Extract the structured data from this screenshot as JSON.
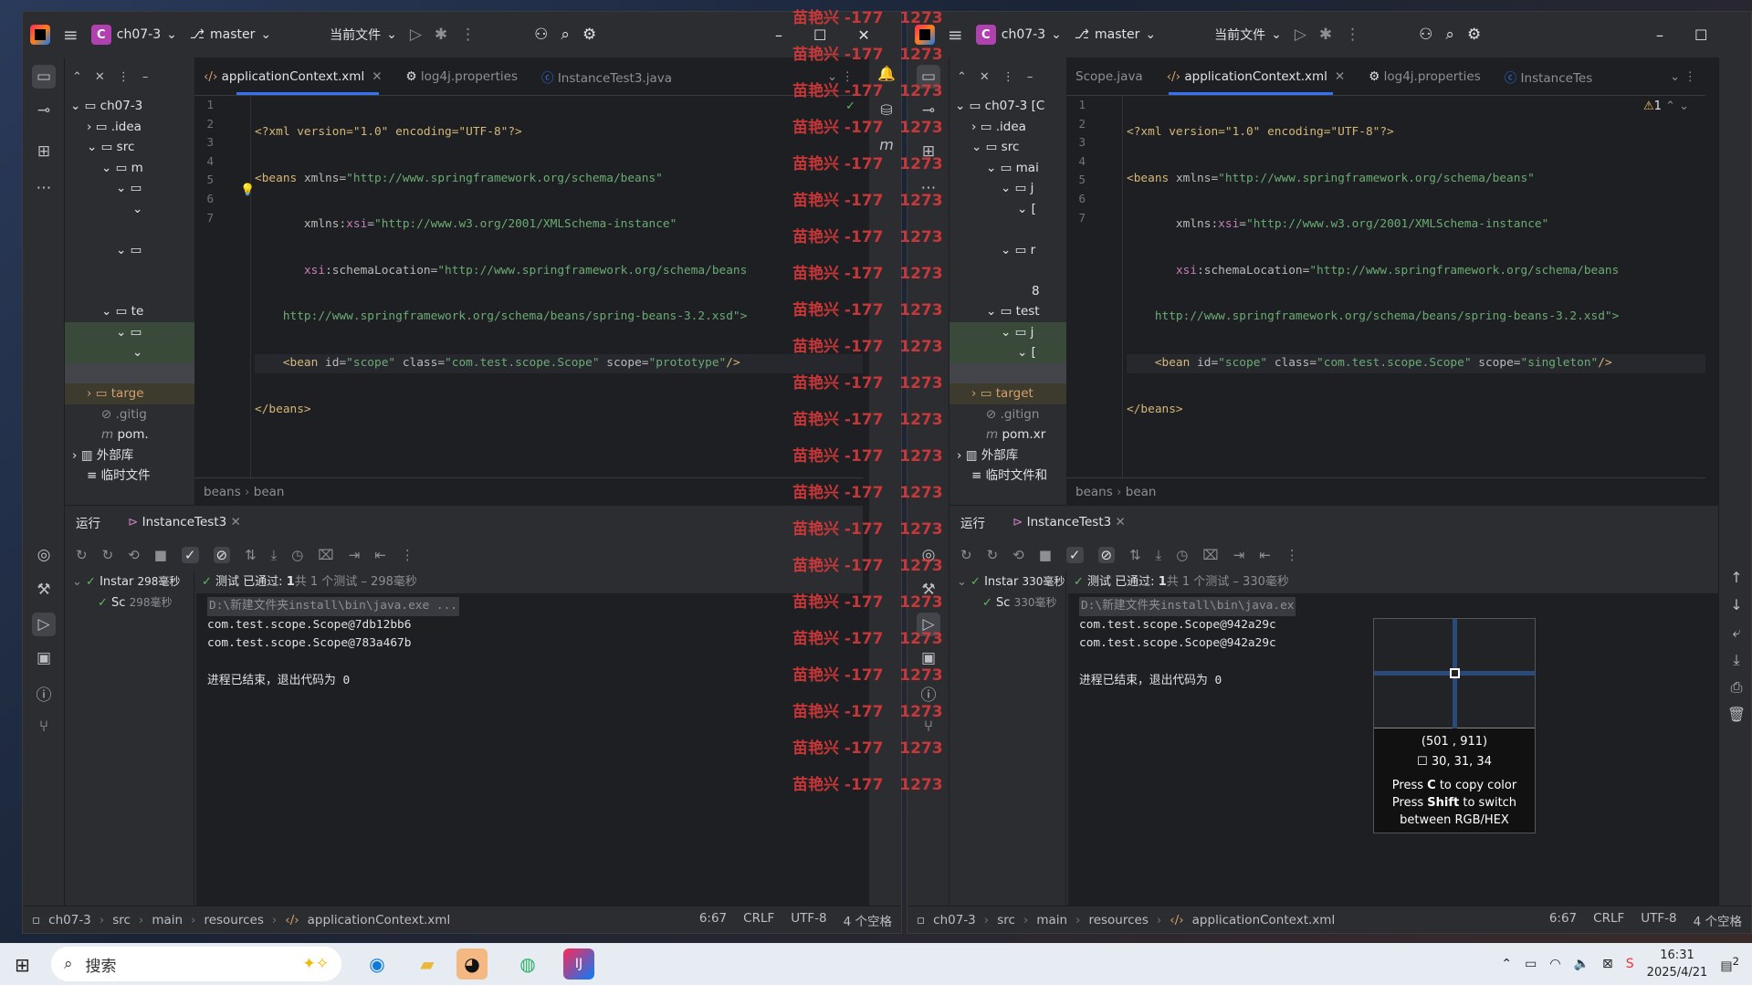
{
  "left": {
    "project": "ch07-3",
    "branch": "master",
    "run_config": "当前文件",
    "tabs": [
      {
        "label": "applicationContext.xml",
        "active": true
      },
      {
        "label": "log4j.properties"
      },
      {
        "label": "InstanceTest3.java"
      }
    ],
    "tree": [
      "ch07-3",
      ".idea",
      "src",
      "m",
      "",
      "",
      "",
      "te",
      "",
      "",
      "",
      "targe",
      ".gitig",
      "pom.",
      "外部库",
      "临时文件"
    ],
    "lines": [
      "1",
      "2",
      "3",
      "4",
      "5",
      "6",
      "7"
    ],
    "code": {
      "l1": "<?xml version=\"1.0\" encoding=\"UTF-8\"?>",
      "l2a": "<beans ",
      "l2b": "xmlns=",
      "l2c": "\"http://www.springframework.org/schema/beans\"",
      "l3a": "       xmlns:",
      "l3b": "xsi",
      "l3c": "=",
      "l3d": "\"http://www.w3.org/2001/XMLSchema-instance\"",
      "l4a": "       ",
      "l4b": "xsi",
      "l4c": ":schemaLocation=",
      "l4d": "\"http://www.springframework.org/schema/beans",
      "l5": "    http://www.springframework.org/schema/beans/spring-beans-3.2.xsd\">",
      "l6a": "    <bean ",
      "l6b": "id=",
      "l6c": "\"scope\" ",
      "l6d": "class=",
      "l6e": "\"com.test.scope.Scope\" ",
      "l6f": "scope=",
      "l6g": "\"prototype\"",
      "l6h": "/>",
      "l7": "</beans>"
    },
    "breadcrumb": [
      "beans",
      "bean"
    ],
    "run_tabs": [
      "运行",
      "InstanceTest3"
    ],
    "run_tree": [
      {
        "label": "Instar",
        "time": "298毫秒"
      },
      {
        "label": "Sc",
        "time": "298毫秒"
      }
    ],
    "result_prefix": "测试 已通过: ",
    "result_count": "1",
    "result_suffix": "共 1 个测试 – 298毫秒",
    "console": [
      "D:\\新建文件夹install\\bin\\java.exe ...",
      "com.test.scope.Scope@7db12bb6",
      "com.test.scope.Scope@783a467b",
      "",
      "进程已结束，退出代码为 0"
    ],
    "status_path": [
      "ch07-3",
      "src",
      "main",
      "resources",
      "applicationContext.xml"
    ],
    "status_right": [
      "6:67",
      "CRLF",
      "UTF-8",
      "4 个空格"
    ]
  },
  "right": {
    "project": "ch07-3",
    "branch": "master",
    "run_config": "当前文件",
    "tabs": [
      {
        "label": "Scope.java"
      },
      {
        "label": "applicationContext.xml",
        "active": true
      },
      {
        "label": "log4j.properties"
      },
      {
        "label": "InstanceTes"
      }
    ],
    "tree": [
      "ch07-3 [C",
      ".idea",
      "src",
      "mai",
      "j",
      "[",
      "r",
      "",
      "8",
      "test",
      "j",
      "[",
      "",
      "target",
      ".gitign",
      "pom.xr",
      "外部库",
      "临时文件和"
    ],
    "lines": [
      "1",
      "2",
      "3",
      "4",
      "5",
      "6",
      "7"
    ],
    "warning_count": "1",
    "code": {
      "l6g": "\"singleton\""
    },
    "breadcrumb": [
      "beans",
      "bean"
    ],
    "run_tabs": [
      "运行",
      "InstanceTest3"
    ],
    "run_tree": [
      {
        "label": "Instar",
        "time": "330毫秒"
      },
      {
        "label": "Sc",
        "time": "330毫秒"
      }
    ],
    "result_prefix": "测试 已通过: ",
    "result_count": "1",
    "result_suffix": "共 1 个测试 – 330毫秒",
    "console": [
      "D:\\新建文件夹install\\bin\\java.ex",
      "com.test.scope.Scope@942a29c",
      "com.test.scope.Scope@942a29c",
      "",
      "进程已结束，退出代码为 0"
    ],
    "status_path": [
      "ch07-3",
      "src",
      "main",
      "resources",
      "applicationContext.xml"
    ],
    "status_right": [
      "6:67",
      "CRLF",
      "UTF-8",
      "4 个空格"
    ]
  },
  "watermark": {
    "name": "苗艳兴",
    "a": "-177",
    "b": "1273"
  },
  "picker": {
    "coords": "(501 , 911)",
    "rgb": "30,   31,   34",
    "line1_a": "Press ",
    "line1_b": "C",
    "line1_c": " to copy color",
    "line2_a": "Press ",
    "line2_b": "Shift",
    "line2_c": " to switch",
    "line3": "between RGB/HEX"
  },
  "taskbar": {
    "search": "搜索",
    "time": "16:31",
    "date": "2025/4/21",
    "notif": "2"
  }
}
